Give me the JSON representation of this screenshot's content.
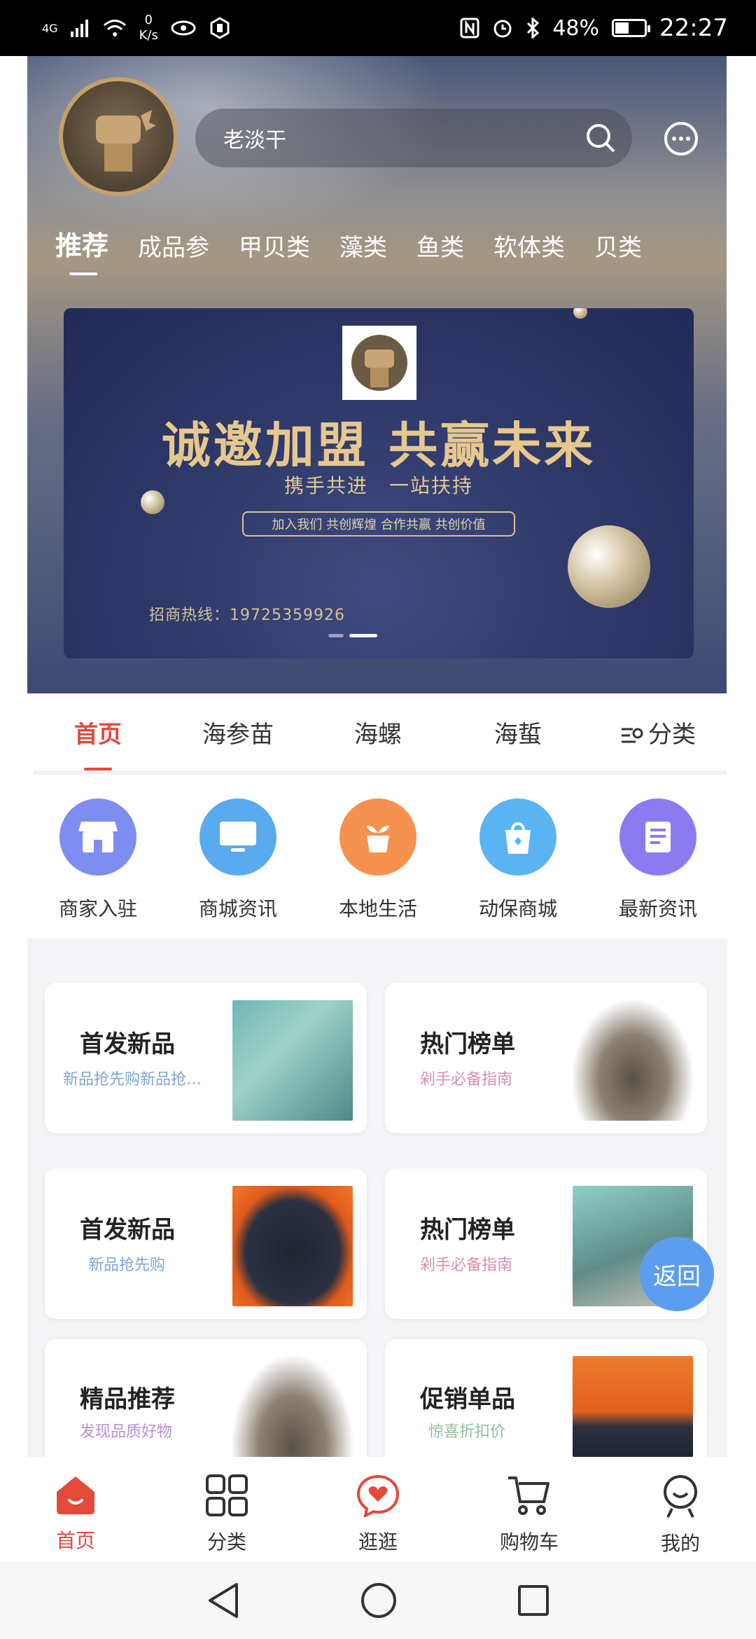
{
  "status_bar": {
    "network": "4G",
    "net_speed_value": "0",
    "net_speed_unit": "K/s",
    "battery": "48%",
    "battery_level": 0.48,
    "time": "22:27"
  },
  "header": {
    "search_text": "老淡干",
    "category_tabs": [
      "推荐",
      "成品参",
      "甲贝类",
      "藻类",
      "鱼类",
      "软体类",
      "贝类"
    ],
    "active_category": "推荐"
  },
  "banner": {
    "headline": "诚邀加盟 共赢未来",
    "subtitle": "携手共进　一站扶持",
    "pill": "加入我们  共创辉煌  合作共赢  共创价值",
    "hotline": "招商热线：19725359926",
    "slide_count": 2,
    "active_slide": 2
  },
  "sub_tabs": [
    "首页",
    "海参苗",
    "海螺",
    "海蜇",
    "分类"
  ],
  "active_sub_tab": "首页",
  "quick_links": [
    {
      "label": "商家入驻",
      "icon": "store-icon",
      "color": "#7d8ef0"
    },
    {
      "label": "商城资讯",
      "icon": "monitor-icon",
      "color": "#5aaaf0"
    },
    {
      "label": "本地生活",
      "icon": "plant-pot-icon",
      "color": "#f6924f"
    },
    {
      "label": "动保商城",
      "icon": "shopping-bag-icon",
      "color": "#5ab4f2"
    },
    {
      "label": "最新资讯",
      "icon": "document-icon",
      "color": "#8a7cf0"
    }
  ],
  "cards": [
    {
      "title": "首发新品",
      "subtitle": "新品抢先购新品抢先购",
      "subtitle_color": "#7fa6d9"
    },
    {
      "title": "热门榜单",
      "subtitle": "剁手必备指南",
      "subtitle_color": "#d98fb0"
    },
    {
      "title": "首发新品",
      "subtitle": "新品抢先购",
      "subtitle_color": "#7fa6d9"
    },
    {
      "title": "热门榜单",
      "subtitle": "剁手必备指南",
      "subtitle_color": "#d98fb0"
    },
    {
      "title": "精品推荐",
      "subtitle": "发现品质好物",
      "subtitle_color": "#b78fd6"
    },
    {
      "title": "促销单品",
      "subtitle": "惊喜折扣价",
      "subtitle_color": "#8fc09a"
    }
  ],
  "back_button": "返回",
  "bottom_nav": [
    {
      "label": "首页",
      "icon": "home-icon"
    },
    {
      "label": "分类",
      "icon": "grid-icon"
    },
    {
      "label": "逛逛",
      "icon": "heart-chat-icon"
    },
    {
      "label": "购物车",
      "icon": "cart-icon"
    },
    {
      "label": "我的",
      "icon": "profile-icon"
    }
  ],
  "active_nav": "首页",
  "colors": {
    "accent": "#e34a3a",
    "back_button": "#5c9df0"
  }
}
